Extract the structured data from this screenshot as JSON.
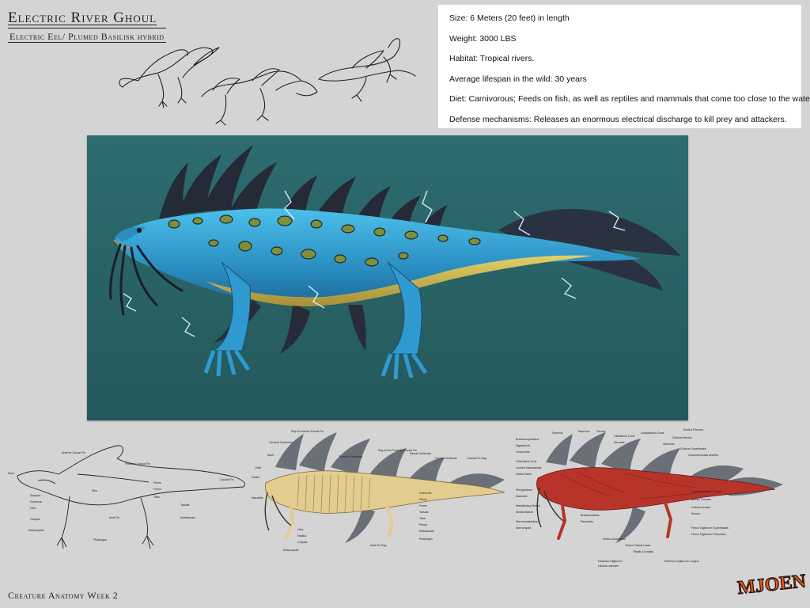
{
  "header": {
    "title": "Electric River Ghoul",
    "subtitle": "Electric Eel/ Plumed Basilisk hybrid"
  },
  "info_card": {
    "size": "Size: 6 Meters (20 feet) in length",
    "weight": "Weight: 3000 LBS",
    "habitat": "Habitat: Tropical rivers.",
    "lifespan": "Average lifespan in the wild: 30 years",
    "diet": "Diet: Carnivorous; Feeds on fish, as well as reptiles and mammals that come too close to the water.",
    "defense": "Defense mechanisms: Releases an enormous electrical discharge to kill prey and attackers."
  },
  "footer": {
    "caption": "Creature Anatomy Week 2"
  },
  "logo": {
    "text": "MJOEN"
  },
  "colors": {
    "background": "#d4d4d4",
    "panel": "#2d6c6f",
    "creature_skin": "#3aa6d6",
    "creature_belly": "#d8c25a",
    "spines": "#2a2f3a",
    "lightning": "#bfe8ff",
    "skeleton": "#e3cc8f",
    "muscle": "#b8342a",
    "logo": "#e05a1a"
  },
  "diagrams": {
    "outline": {
      "labels": [
        "Skull",
        "Scapula",
        "Humerus",
        "Ulna",
        "Carpals",
        "Metacarpals",
        "Phalanges",
        "Anterior Dorsal Fin",
        "Posterior Dorsal Fin",
        "Ribs",
        "Pelvis",
        "Femur",
        "Tibia",
        "Tarsals",
        "Metatarsals",
        "Anal Fin",
        "Caudal Fin"
      ]
    },
    "skeleton": {
      "labels": [
        "Ray of Anterior Dorsal Fin",
        "Cervical Vertebrae",
        "Skull",
        "Orbit",
        "Nostril",
        "Mandible",
        "Thoracic Vertebrae",
        "Ray of the Posterior Dorsal Fin",
        "Sacral Vertebrae",
        "Caudal Vertebrae",
        "Caudal Fin Ray",
        "Chevrons",
        "Pelvis",
        "Femur",
        "Tarsals",
        "Tibia",
        "Fibula",
        "Metatarsals",
        "Phalanges",
        "Anal Fin Ray",
        "Ulna",
        "Radius",
        "Carpals",
        "Metacarpals"
      ]
    },
    "muscles": {
      "labels": [
        "Splenius",
        "Trapezius",
        "Triceps",
        "Brachiocephalicus",
        "Digastricus",
        "Temporalis",
        "Orbicularis Oculi",
        "Levator Nasolabialis",
        "Dilator Naris",
        "Pterygoideus",
        "Masseter",
        "Mandibulary Barbel",
        "Mental Barbel",
        "Sternomastoideus",
        "Sternohyoid",
        "Serratus",
        "Latissimus Dorsi",
        "Longissimus Dorsi",
        "Gluteus Medius",
        "Rectus Femoris",
        "Sartorius",
        "Gluteus Superficialis",
        "Caudofemoralis Anterior",
        "Caudofemoralis Longus",
        "Biceps Femoris",
        "Gastrocnemius",
        "Soleus",
        "Tibialis Cranialis",
        "Extensor Digitorum",
        "Ulnaris Lateralis",
        "Extensor Digitorum Longus",
        "Tensor Fascia Latae",
        "Rectus Abdominis",
        "Brachioradialis",
        "Pectoralis",
        "Flexor Digitorum Superficialis",
        "Flexor Digitorum Profundus"
      ]
    }
  }
}
